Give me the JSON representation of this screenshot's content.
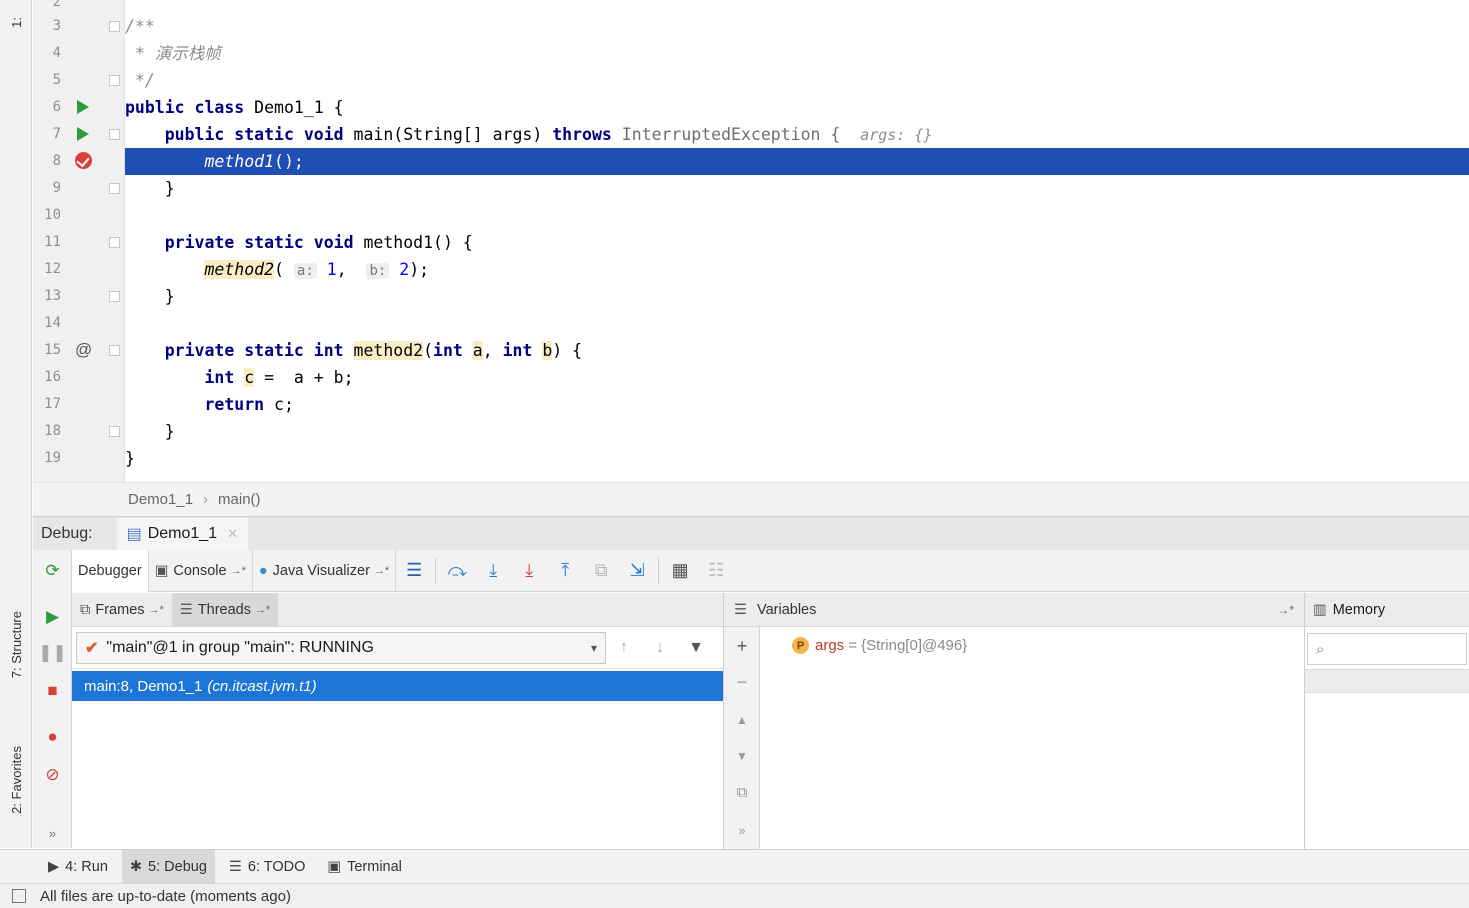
{
  "left_strip": {
    "top_tab": "1:",
    "structure_tab": "7: Structure",
    "favorites_tab": "2: Favorites"
  },
  "editor": {
    "lines": [
      {
        "num": "2",
        "code": ""
      },
      {
        "num": "3",
        "code": "/**"
      },
      {
        "num": "4",
        "code": " * 演示栈帧"
      },
      {
        "num": "5",
        "code": " */"
      },
      {
        "num": "6",
        "code": "public class Demo1_1 {"
      },
      {
        "num": "7",
        "code": "    public static void main(String[] args) throws InterruptedException {  args: {}"
      },
      {
        "num": "8",
        "code": "        method1();"
      },
      {
        "num": "9",
        "code": "    }"
      },
      {
        "num": "10",
        "code": ""
      },
      {
        "num": "11",
        "code": "    private static void method1() {"
      },
      {
        "num": "12",
        "code": "        method2( a: 1,  b: 2);"
      },
      {
        "num": "13",
        "code": "    }"
      },
      {
        "num": "14",
        "code": ""
      },
      {
        "num": "15",
        "code": "    private static int method2(int a, int b) {"
      },
      {
        "num": "16",
        "code": "        int c =  a + b;"
      },
      {
        "num": "17",
        "code": "        return c;"
      },
      {
        "num": "18",
        "code": "    }"
      },
      {
        "num": "19",
        "code": "}"
      }
    ],
    "tokens": {
      "comment_open": "/**",
      "comment_text": " * 演示栈帧",
      "comment_close": " */",
      "kw_public": "public",
      "kw_class": "class",
      "class_name": "Demo1_1 {",
      "kw_static": "static",
      "kw_void": "void",
      "kw_private": "private",
      "kw_int": "int",
      "kw_throws": "throws",
      "kw_return": "return",
      "main_sig": "main(String[] args)",
      "exception": "InterruptedException {",
      "inline_args": "args: {}",
      "call_method1": "method1",
      "call_suffix": "();",
      "close_brace": "}",
      "method1_decl": "method1() {",
      "call_method2": "method2",
      "paren_open": "(",
      "hint_a": "a:",
      "val_1": "1",
      "comma": ",",
      "hint_b": "b:",
      "val_2": "2",
      "call_end": ");",
      "method2_name": "method2",
      "param_a": "a",
      "param_b": "b",
      "method2_end": ") {",
      "var_c": "c",
      "sum": " =  a + b;",
      "ret_val": " c;"
    }
  },
  "breadcrumb": {
    "file": "Demo1_1",
    "method": "main()"
  },
  "debug": {
    "label": "Debug:",
    "session_tab": "Demo1_1",
    "tabs": {
      "debugger": "Debugger",
      "console": "Console",
      "java_visualizer": "Java Visualizer"
    },
    "frames_tab": "Frames",
    "threads_tab": "Threads",
    "thread_select": "\"main\"@1 in group \"main\": RUNNING",
    "frame": {
      "location": "main:8, Demo1_1",
      "package": "(cn.itcast.jvm.t1)"
    },
    "variables_title": "Variables",
    "variable": {
      "badge": "P",
      "name": "args",
      "value": "= {String[0]@496}"
    },
    "memory_title": "Memory"
  },
  "tool_tabs": {
    "run": "4: Run",
    "debug": "5: Debug",
    "todo": "6: TODO",
    "terminal": "Terminal"
  },
  "status": {
    "text": "All files are up-to-date (moments ago)"
  },
  "colors": {
    "highlight": "#1f4fb4",
    "frame_selected": "#1e75d8",
    "keyword": "#000080",
    "breakpoint": "#d8413c"
  }
}
